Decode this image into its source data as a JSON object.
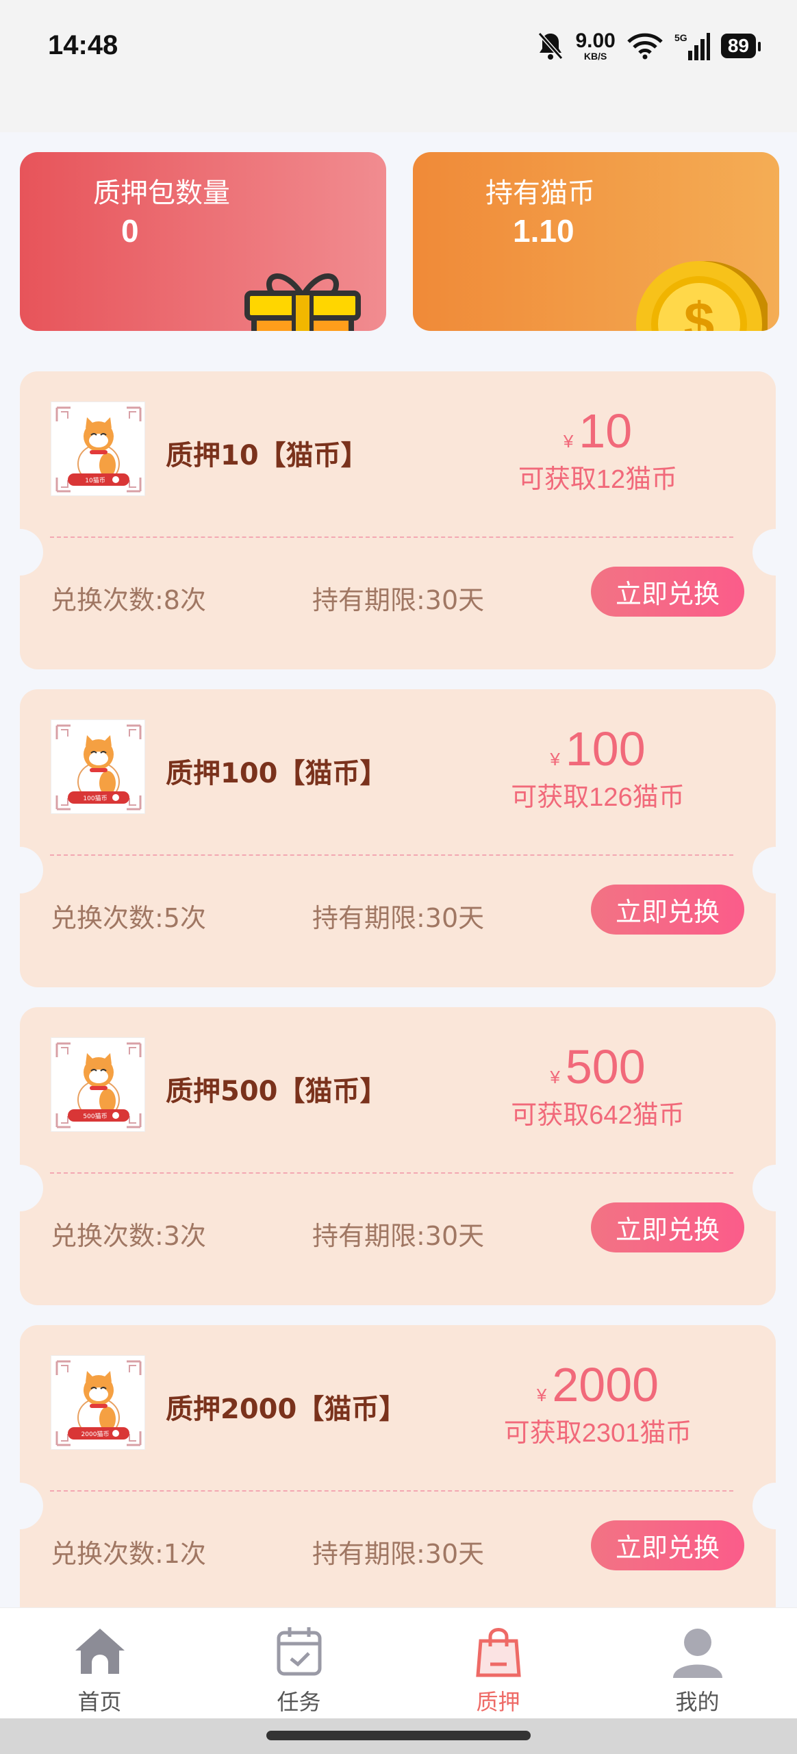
{
  "status_bar": {
    "time": "14:48",
    "net_speed": "9.00",
    "net_unit": "KB/S",
    "network": "5G",
    "battery": "89",
    "icons": [
      "mute-bell-icon",
      "wifi-icon",
      "signal-icon",
      "battery-icon"
    ]
  },
  "stats": {
    "pledge_count_label": "质押包数量",
    "pledge_count_value": "0",
    "coins_label": "持有猫币",
    "coins_value": "1.10"
  },
  "pledges": [
    {
      "title": "质押10【猫币】",
      "thumb_label": "10猫币",
      "currency": "¥",
      "price": "10",
      "gain": "可获取12猫币",
      "times": "兑换次数:8次",
      "term": "持有期限:30天",
      "button": "立即兑换"
    },
    {
      "title": "质押100【猫币】",
      "thumb_label": "100猫币",
      "currency": "¥",
      "price": "100",
      "gain": "可获取126猫币",
      "times": "兑换次数:5次",
      "term": "持有期限:30天",
      "button": "立即兑换"
    },
    {
      "title": "质押500【猫币】",
      "thumb_label": "500猫币",
      "currency": "¥",
      "price": "500",
      "gain": "可获取642猫币",
      "times": "兑换次数:3次",
      "term": "持有期限:30天",
      "button": "立即兑换"
    },
    {
      "title": "质押2000【猫币】",
      "thumb_label": "2000猫币",
      "currency": "¥",
      "price": "2000",
      "gain": "可获取2301猫币",
      "times": "兑换次数:1次",
      "term": "持有期限:30天",
      "button": "立即兑换"
    }
  ],
  "tabs": [
    {
      "label": "首页",
      "icon": "home-icon",
      "active": false
    },
    {
      "label": "任务",
      "icon": "calendar-check-icon",
      "active": false
    },
    {
      "label": "质押",
      "icon": "shopping-bag-icon",
      "active": true
    },
    {
      "label": "我的",
      "icon": "user-icon",
      "active": false
    }
  ],
  "colors": {
    "pledge_card": "#e7545a",
    "coins_card": "#f08a38",
    "coupon_bg": "#fae6d9",
    "accent_pink": "#f1697a",
    "title_brown": "#7a321c",
    "active_tab": "#ee6a66"
  }
}
